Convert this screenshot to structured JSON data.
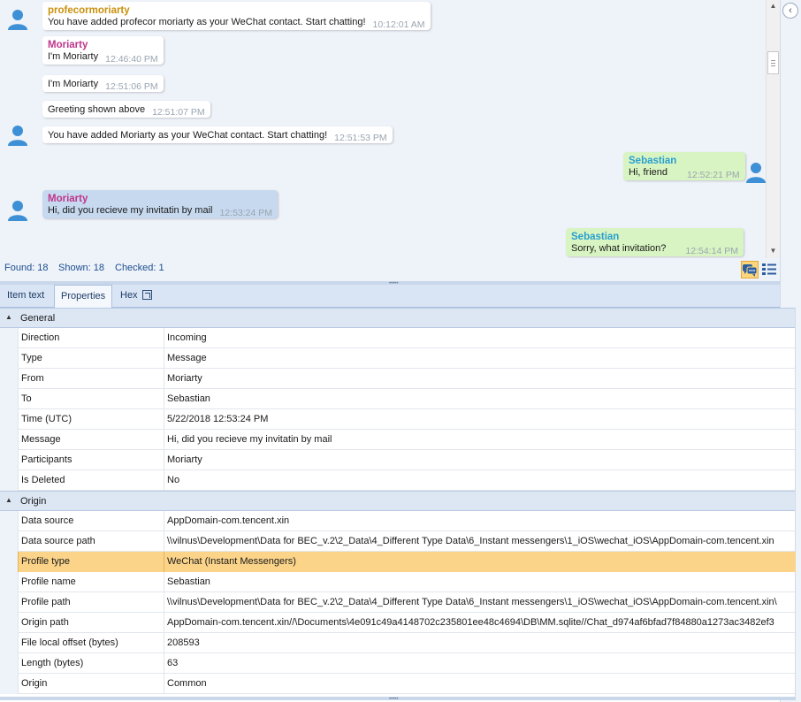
{
  "chat": {
    "messages": [
      {
        "direction": "in",
        "sender": "profecormoriarty",
        "sender_color": "#c9900c",
        "text": "You have added profecor moriarty as your WeChat contact. Start chatting!",
        "time": "10:12:01 AM",
        "avatar": true,
        "selected": false
      },
      {
        "direction": "in",
        "sender": "Moriarty",
        "sender_color": "#c0358c",
        "text": "I'm Moriarty",
        "time": "12:46:40 PM",
        "avatar": false,
        "selected": false
      },
      {
        "direction": "in",
        "sender": "",
        "text": "I'm Moriarty",
        "time": "12:51:06 PM",
        "avatar": false,
        "selected": false
      },
      {
        "direction": "in",
        "sender": "",
        "text": "Greeting shown above",
        "time": "12:51:07 PM",
        "avatar": false,
        "selected": false
      },
      {
        "direction": "in",
        "sender": "",
        "text": "You have added Moriarty as your WeChat contact. Start chatting!",
        "time": "12:51:53 PM",
        "avatar": true,
        "selected": false
      },
      {
        "direction": "out",
        "sender": "Sebastian",
        "sender_color": "#2a9fd0",
        "text": "Hi, friend",
        "time": "12:52:21 PM",
        "avatar": true,
        "selected": false
      },
      {
        "direction": "in",
        "sender": "Moriarty",
        "sender_color": "#c0358c",
        "text": "Hi, did you recieve my invitatin by mail",
        "time": "12:53:24 PM",
        "avatar": true,
        "selected": true
      },
      {
        "direction": "out",
        "sender": "Sebastian",
        "sender_color": "#2a9fd0",
        "text": "Sorry, what invitation?",
        "time": "12:54:14 PM",
        "avatar": false,
        "selected": false
      }
    ]
  },
  "status": {
    "found": "Found: 18",
    "shown": "Shown: 18",
    "checked": "Checked: 1"
  },
  "tabs": [
    {
      "label": "Item text",
      "active": false
    },
    {
      "label": "Properties",
      "active": true
    },
    {
      "label": "Hex",
      "active": false
    }
  ],
  "properties": {
    "groups": [
      {
        "name": "General",
        "rows": [
          {
            "name": "Direction",
            "value": "Incoming"
          },
          {
            "name": "Type",
            "value": "Message"
          },
          {
            "name": "From",
            "value": "Moriarty"
          },
          {
            "name": "To",
            "value": "Sebastian"
          },
          {
            "name": "Time (UTC)",
            "value": "5/22/2018 12:53:24 PM"
          },
          {
            "name": "Message",
            "value": "Hi, did you recieve my invitatin by mail"
          },
          {
            "name": "Participants",
            "value": "Moriarty"
          },
          {
            "name": "Is Deleted",
            "value": "No"
          }
        ]
      },
      {
        "name": "Origin",
        "rows": [
          {
            "name": "Data source",
            "value": "AppDomain-com.tencent.xin"
          },
          {
            "name": "Data source path",
            "value": "\\\\vilnus\\Development\\Data for BEC_v.2\\2_Data\\4_Different Type Data\\6_Instant messengers\\1_iOS\\wechat_iOS\\AppDomain-com.tencent.xin"
          },
          {
            "name": "Profile type",
            "value": "WeChat (Instant Messengers)",
            "highlighted": true
          },
          {
            "name": "Profile name",
            "value": "Sebastian"
          },
          {
            "name": "Profile path",
            "value": "\\\\vilnus\\Development\\Data for BEC_v.2\\2_Data\\4_Different Type Data\\6_Instant messengers\\1_iOS\\wechat_iOS\\AppDomain-com.tencent.xin\\"
          },
          {
            "name": "Origin path",
            "value": "AppDomain-com.tencent.xin//\\Documents\\4e091c49a4148702c235801ee48c4694\\DB\\MM.sqlite//Chat_d974af6bfad7f84880a1273ac3482ef3"
          },
          {
            "name": "File local offset (bytes)",
            "value": "208593"
          },
          {
            "name": "Length (bytes)",
            "value": "63"
          },
          {
            "name": "Origin",
            "value": "Common"
          }
        ]
      }
    ]
  }
}
